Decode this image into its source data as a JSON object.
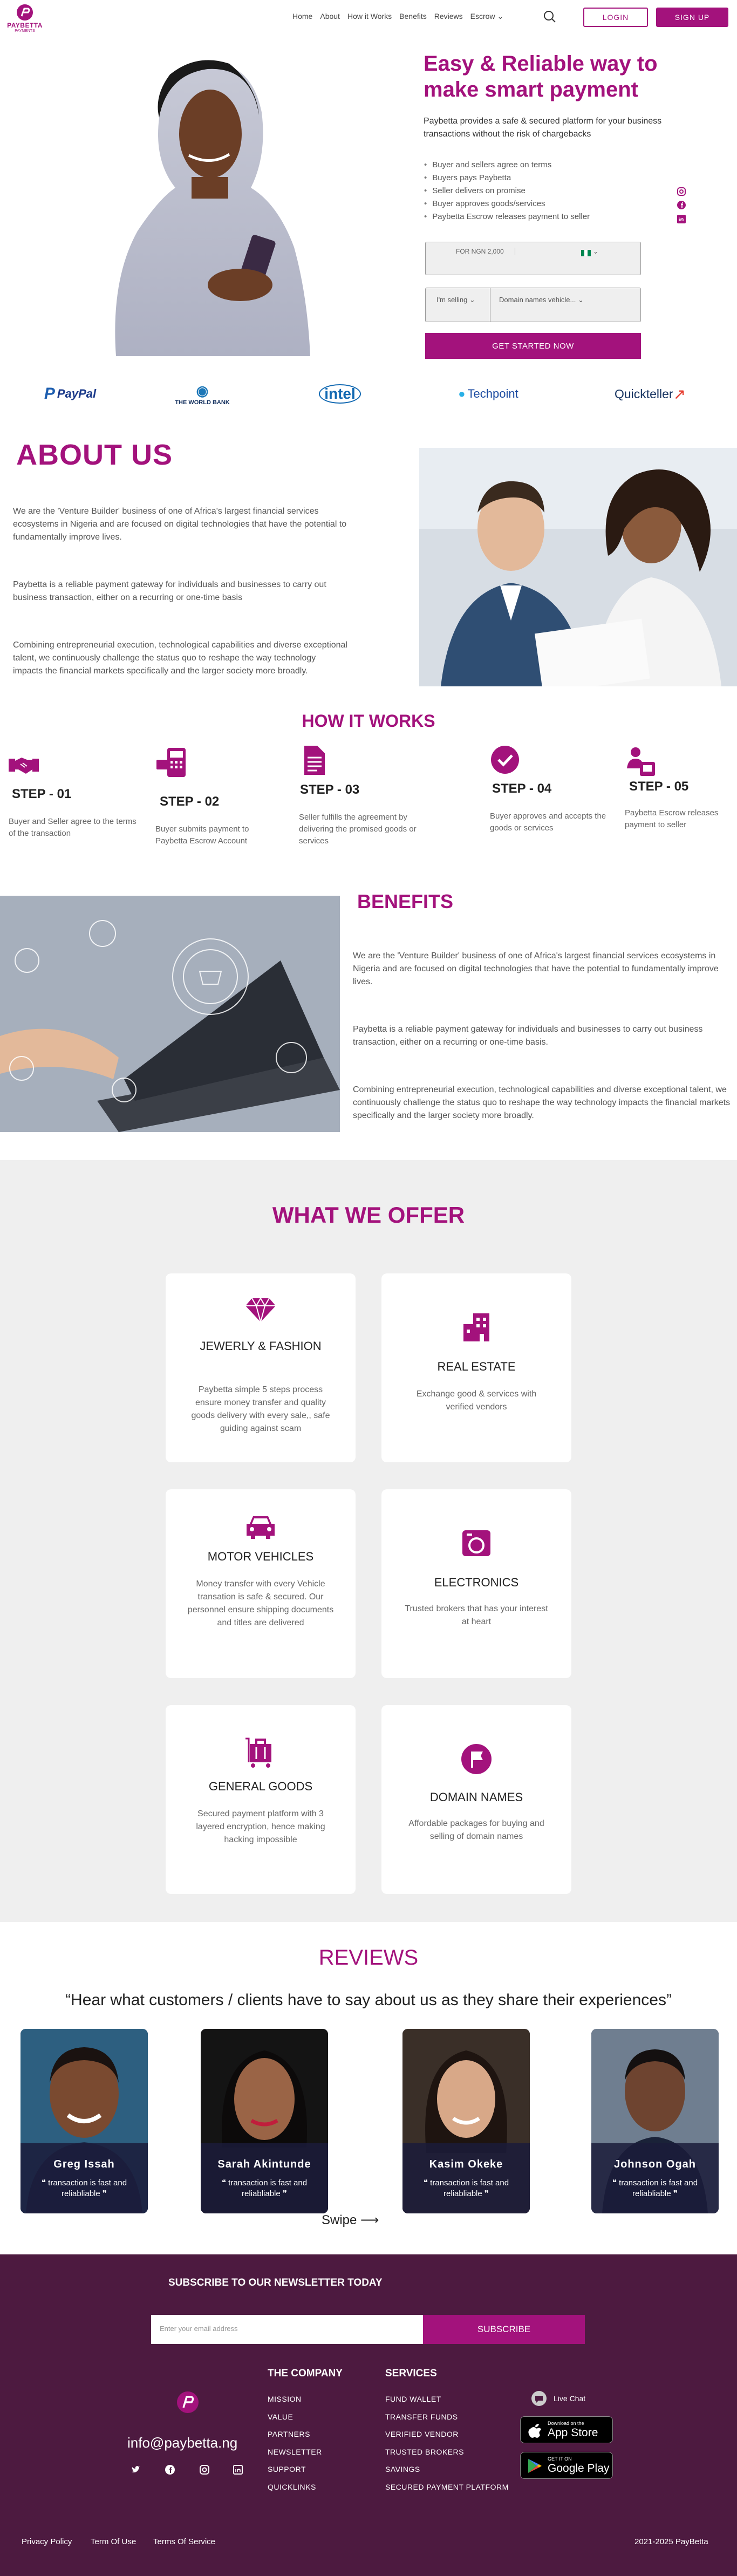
{
  "header": {
    "logo_text": "PAYBETTA",
    "logo_sub": "PAYMENTS",
    "nav": [
      "Home",
      "About",
      "How it Works",
      "Benefits",
      "Reviews",
      "Escrow"
    ],
    "login": "LOGIN",
    "signup": "SIGN UP"
  },
  "hero": {
    "title": "Easy & Reliable way to make smart payment",
    "subtitle": "Paybetta provides a safe & secured platform for your business transactions without the risk of chargebacks",
    "steps": [
      "Buyer and sellers agree on terms",
      "Buyers pays Paybetta",
      "Seller delivers on promise",
      "Buyer approves goods/services",
      "Paybetta Escrow releases payment to seller"
    ],
    "amount_placeholder": "FOR NGN 2,000",
    "role_select": "I'm selling",
    "category_select": "Domain names vehicle...",
    "cta": "GET STARTED NOW"
  },
  "partners": [
    "PayPal",
    "THE WORLD BANK",
    "intel",
    "Techpoint",
    "Quickteller"
  ],
  "about": {
    "title": "ABOUT US",
    "paragraphs": [
      "We are the 'Venture Builder' business of one of Africa's largest financial services ecosystems in Nigeria and are focused on digital technologies that have the potential to fundamentally improve lives.",
      "Paybetta is a reliable payment gateway for individuals and businesses to carry out business transaction, either on a recurring or one-time basis",
      "Combining entrepreneurial execution, technological capabilities and diverse exceptional talent, we continuously challenge the status quo to reshape the way technology impacts the financial markets specifically and the larger society more broadly."
    ]
  },
  "how": {
    "title": "HOW IT WORKS",
    "steps": [
      {
        "label": "STEP - 01",
        "desc": "Buyer and Seller agree to the terms of the transaction"
      },
      {
        "label": "STEP - 02",
        "desc": "Buyer submits payment to Paybetta Escrow Account"
      },
      {
        "label": "STEP - 03",
        "desc": "Seller fulfills the agreement by delivering the promised goods or services"
      },
      {
        "label": "STEP - 04",
        "desc": "Buyer approves and accepts the goods or services"
      },
      {
        "label": "STEP - 05",
        "desc": "Paybetta Escrow releases payment to seller"
      }
    ]
  },
  "benefits": {
    "title": "BENEFITS",
    "paragraphs": [
      "We are the 'Venture Builder' business of one of Africa's largest financial services ecosystems in Nigeria and are focused on digital technologies that have the potential to fundamentally improve lives.",
      "Paybetta is a reliable payment gateway for individuals and businesses to carry out business transaction, either on a recurring or one-time basis.",
      "Combining entrepreneurial execution, technological capabilities and diverse exceptional talent, we continuously challenge the status quo to reshape the way technology impacts the financial markets specifically and the larger society more broadly."
    ]
  },
  "offer": {
    "title": "WHAT WE OFFER",
    "cards": [
      {
        "title": "JEWERLY & FASHION",
        "desc": "Paybetta simple 5 steps process ensure money transfer and quality goods delivery with every sale,, safe guiding against scam",
        "icon": "diamond-icon"
      },
      {
        "title": "REAL ESTATE",
        "desc": "Exchange good & services with verified vendors",
        "icon": "building-icon"
      },
      {
        "title": "MOTOR VEHICLES",
        "desc": "Money transfer with every Vehicle transation is safe & secured. Our personnel ensure shipping documents and titles are delivered",
        "icon": "car-icon"
      },
      {
        "title": "ELECTRONICS",
        "desc": "Trusted brokers that has your interest at heart",
        "icon": "electronics-icon"
      },
      {
        "title": "GENERAL GOODS",
        "desc": "Secured payment platform with 3 layered encryption, hence making hacking impossible",
        "icon": "luggage-icon"
      },
      {
        "title": "DOMAIN NAMES",
        "desc": "Affordable packages for buying and selling of domain names",
        "icon": "flag-icon"
      }
    ]
  },
  "reviews": {
    "title": "REVIEWS",
    "quote": "“Hear what customers / clients have to say about us as they share their experiences”",
    "people": [
      {
        "name": "Greg Issah",
        "text": "❝ transaction is fast and reliabliable ❞"
      },
      {
        "name": "Sarah Akintunde",
        "text": "❝ transaction is fast and reliabliable ❞"
      },
      {
        "name": "Kasim Okeke",
        "text": "❝ transaction is fast and reliabliable ❞"
      },
      {
        "name": "Johnson Ogah",
        "text": "❝ transaction is fast and reliabliable ❞"
      }
    ],
    "swipe": "Swipe"
  },
  "footer": {
    "newsletter_title": "SUBSCRIBE TO OUR NEWSLETTER TODAY",
    "email_placeholder": "Enter your email address",
    "subscribe": "SUBSCRIBE",
    "email": "info@paybetta.ng",
    "company_title": "THE COMPANY",
    "company_links": [
      "MISSION",
      "VALUE",
      "PARTNERS",
      "NEWSLETTER",
      "SUPPORT",
      "QUICKLINKS"
    ],
    "services_title": "SERVICES",
    "service_links": [
      "FUND WALLET",
      "TRANSFER FUNDS",
      "VERIFIED VENDOR",
      "TRUSTED BROKERS",
      "SAVINGS",
      "SECURED PAYMENT PLATFORM"
    ],
    "live_chat": "Live Chat",
    "appstore_small": "Download on the",
    "appstore_big": "App Store",
    "play_small": "GET IT ON",
    "play_big": "Google Play",
    "bottom_links": [
      "Privacy Policy",
      "Term Of Use",
      "Terms Of Service"
    ],
    "copyright": "2021-2025 PayBetta"
  },
  "colors": {
    "brand": "#a3127c",
    "footer": "#4d1a40",
    "offer_bg": "#efefef"
  }
}
